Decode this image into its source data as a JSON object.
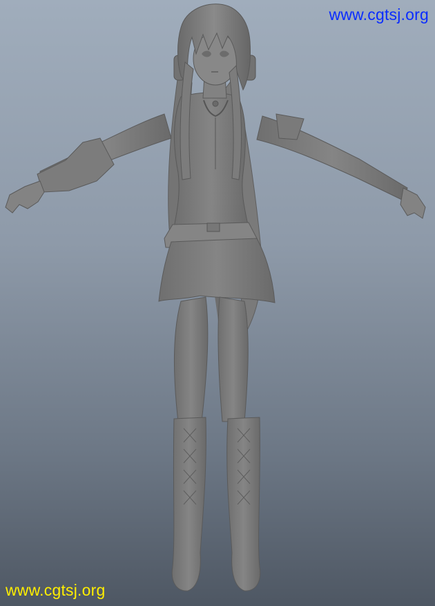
{
  "viewport": {
    "background_top": "#a0adbc",
    "background_bottom": "#4e5763",
    "model_color": "#7e7e7e"
  },
  "watermarks": {
    "top_right": {
      "text": "www.cgtsj.org",
      "color": "#0a2cff"
    },
    "bottom_left": {
      "text": "www.cgtsj.org",
      "color": "#ffee00"
    }
  }
}
